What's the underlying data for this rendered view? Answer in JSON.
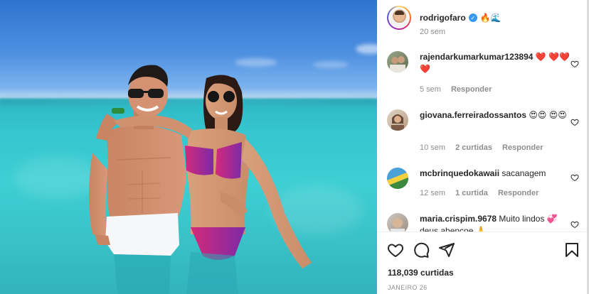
{
  "post": {
    "username": "rodrigofaro",
    "verified_mark": "✓",
    "caption_emoji": "🔥🌊",
    "time": "20 sem",
    "likes": "118,039 curtidas",
    "date": "JANEIRO 26"
  },
  "comments": [
    {
      "username": "rajendarkumarkumar123894",
      "text": "❤️ ❤️❤️❤️",
      "time": "5 sem",
      "likes": "",
      "reply": "Responder"
    },
    {
      "username": "giovana.ferreiradossantos",
      "text": "😍😍 😍😍",
      "time": "10 sem",
      "likes": "2 curtidas",
      "reply": "Responder"
    },
    {
      "username": "mcbrinquedokawaii",
      "text": "sacanagem",
      "time": "12 sem",
      "likes": "1 curtida",
      "reply": "Responder"
    },
    {
      "username": "maria.crispim.9678",
      "text": "Muito lindos 💞 deus abençoe 🙏",
      "time": "",
      "likes": "",
      "reply": ""
    }
  ],
  "icons": {
    "like": "heart-icon",
    "comment": "comment-icon",
    "share": "share-icon",
    "save": "bookmark-icon",
    "verified": "verified-badge-icon"
  },
  "colors": {
    "verified": "#3897f0",
    "text": "#262626",
    "muted": "#8e8e8e"
  }
}
